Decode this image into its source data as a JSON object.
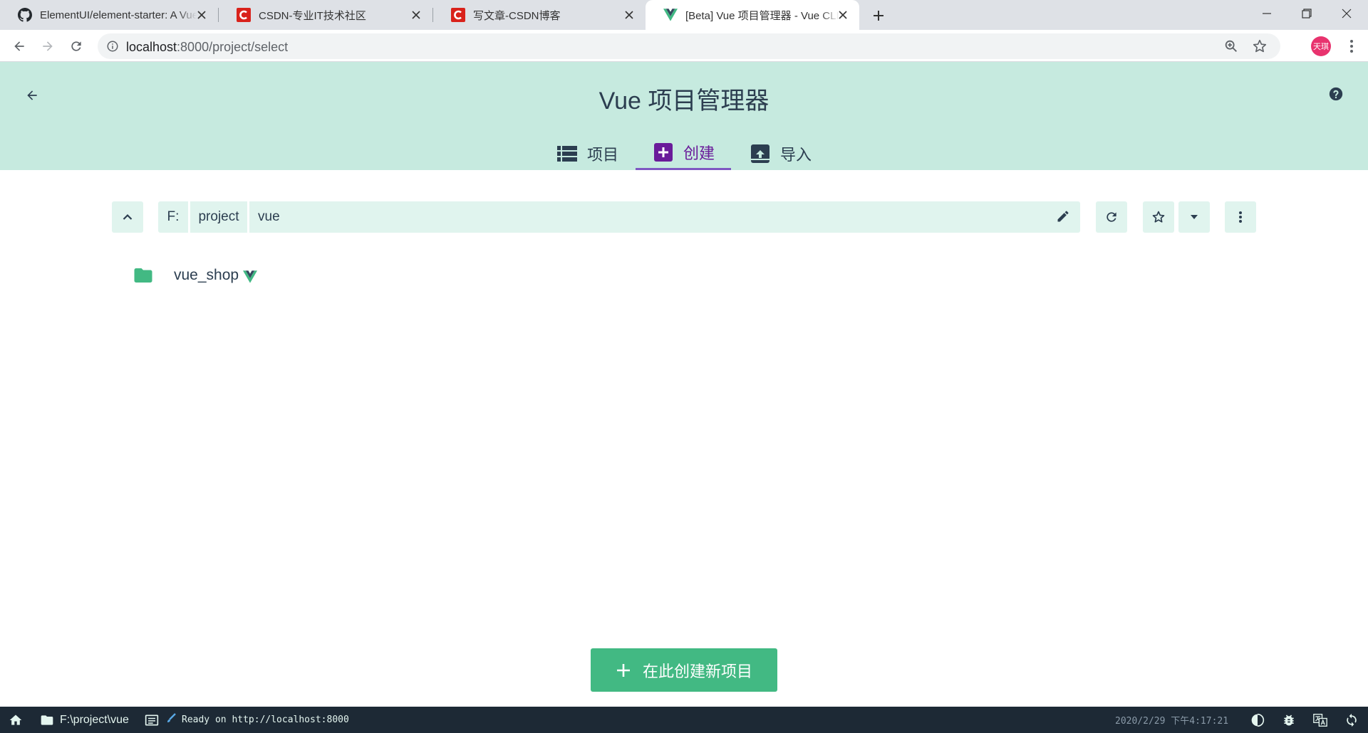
{
  "browser": {
    "tabs": [
      {
        "title": "ElementUI/element-starter: A Vue",
        "favicon": "github-icon",
        "active": false
      },
      {
        "title": "CSDN-专业IT技术社区",
        "favicon": "csdn-icon",
        "active": false
      },
      {
        "title": "写文章-CSDN博客",
        "favicon": "csdn-icon",
        "active": false
      },
      {
        "title": "[Beta] Vue 项目管理器 - Vue CLI",
        "favicon": "vue-icon",
        "active": true
      }
    ],
    "address": {
      "host": "localhost",
      "path": ":8000/project/select"
    },
    "profile_initials": "天琪",
    "profile_color": "#e8336e"
  },
  "app": {
    "title": "Vue 项目管理器",
    "tabs": [
      {
        "label": "项目",
        "icon": "list-icon"
      },
      {
        "label": "创建",
        "icon": "add-box-icon"
      },
      {
        "label": "导入",
        "icon": "unarchive-icon"
      }
    ],
    "active_tab": "创建"
  },
  "path": {
    "segments": [
      "F:",
      "project",
      "vue"
    ]
  },
  "folders": [
    {
      "name": "vue_shop",
      "icon": "folder-icon",
      "badge": "vue-logo-icon"
    }
  ],
  "create_button": {
    "label": "在此创建新项目"
  },
  "status_bar": {
    "cwd": "F:\\project\\vue",
    "log": "Ready on http://localhost:8000",
    "clock": "2020/2/29 下午4:17:21"
  },
  "colors": {
    "header_bg": "#c6eadf",
    "accent": "#42b983",
    "active_tab": "#6a1b9a",
    "status_bg": "#1d2935"
  }
}
